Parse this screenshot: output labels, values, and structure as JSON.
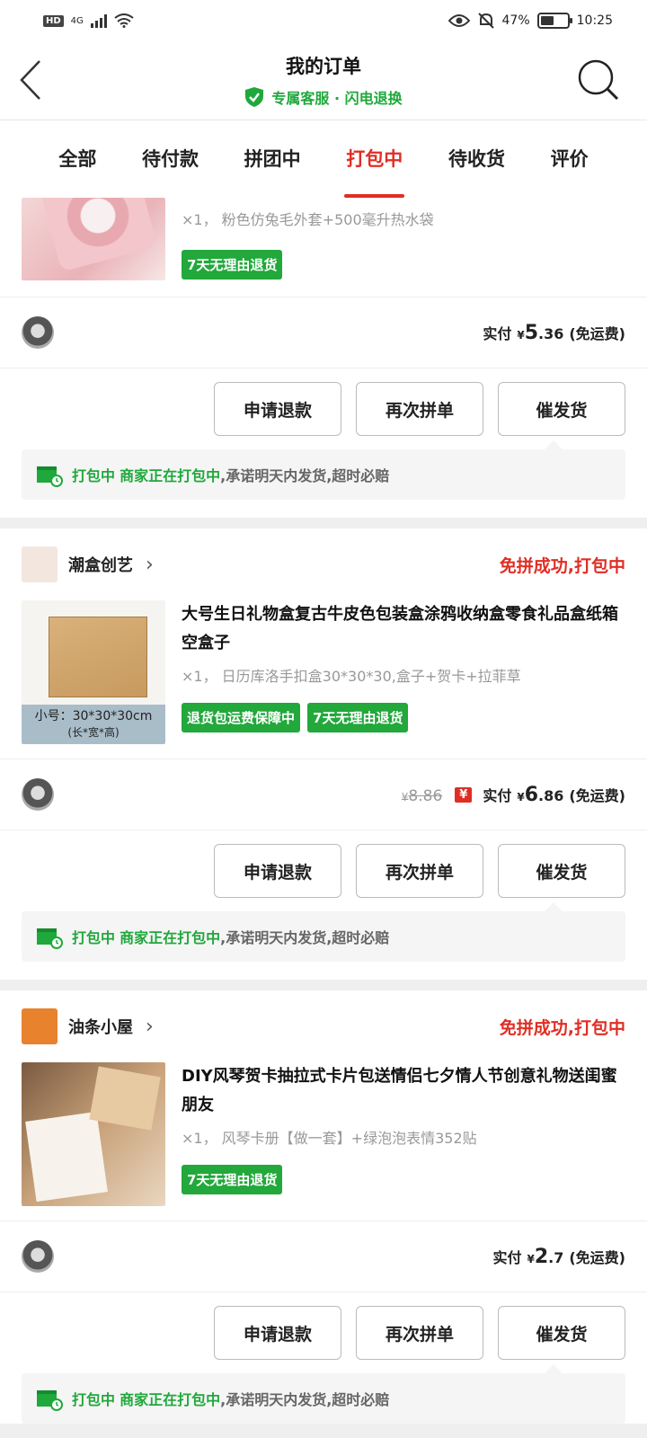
{
  "status_bar": {
    "left": "HD",
    "network": "4G",
    "battery": "47%",
    "time": "10:25"
  },
  "header": {
    "title": "我的订单",
    "subtitle": "专属客服 · 闪电退换"
  },
  "tabs": [
    "全部",
    "待付款",
    "拼团中",
    "打包中",
    "待收货",
    "评价"
  ],
  "active_tab": "打包中",
  "orders": [
    {
      "spec": "×1， 粉色仿兔毛外套+500毫升热水袋",
      "badges": [
        "7天无理由退货"
      ],
      "pay_label": "实付",
      "amount_int": "5",
      "amount_dec": ".36",
      "shipping": "(免运费)"
    },
    {
      "shop": "潮盒创艺",
      "status": "免拼成功,打包中",
      "name": "大号生日礼物盒复古牛皮色包装盒涂鸦收纳盒零食礼品盒纸箱空盒子",
      "spec": "×1， 日历库洛手扣盒30*30*30,盒子+贺卡+拉菲草",
      "thumb_caption": "小号：30*30*30cm",
      "thumb_caption2": "(长*宽*高)",
      "badges": [
        "退货包运费保障中",
        "7天无理由退货"
      ],
      "orig_price": "8.86",
      "pay_label": "实付",
      "amount_int": "6",
      "amount_dec": ".86",
      "shipping": "(免运费)"
    },
    {
      "shop": "油条小屋",
      "status": "免拼成功,打包中",
      "name": "DIY风琴贺卡抽拉式卡片包送情侣七夕情人节创意礼物送闺蜜朋友",
      "spec": "×1， 风琴卡册【做一套】+绿泡泡表情352贴",
      "badges": [
        "7天无理由退货"
      ],
      "pay_label": "实付",
      "amount_int": "2",
      "amount_dec": ".7",
      "shipping": "(免运费)"
    }
  ],
  "buttons": {
    "refund": "申请退款",
    "regroup": "再次拼单",
    "urge": "催发货"
  },
  "notice": {
    "state": "打包中",
    "merchant": "商家正在打包中",
    "rest": ",承诺明天内发货,超时必赔"
  },
  "currency": "¥",
  "colors": {
    "accent": "#e02e24",
    "green": "#22a83b"
  }
}
